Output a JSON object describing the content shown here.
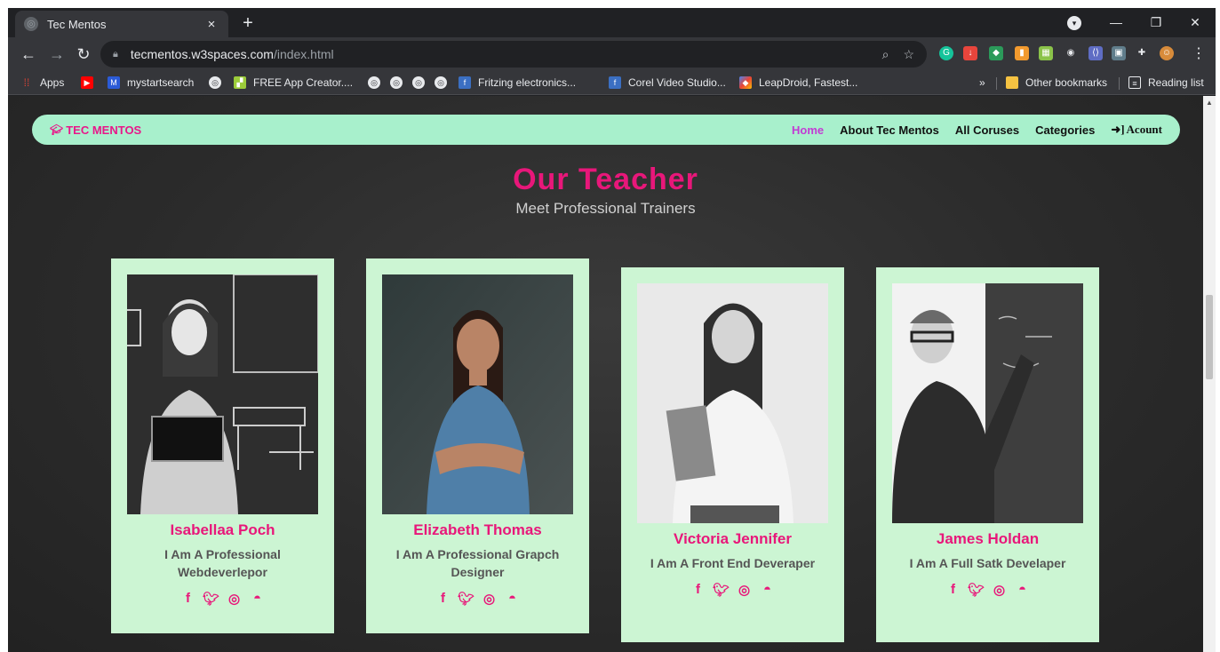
{
  "browser": {
    "tab_title": "Tec Mentos",
    "tab_close": "×",
    "new_tab": "+",
    "url_host": "tecmentos.w3spaces.com",
    "url_path": "/index.html",
    "bookmarks": {
      "apps": "Apps",
      "mystartsearch": "mystartsearch",
      "free_app_creator": "FREE App Creator....",
      "fritzing": "Fritzing electronics...",
      "corel": "Corel Video Studio...",
      "leapdroid": "LeapDroid, Fastest...",
      "more": "»",
      "other_bookmarks": "Other bookmarks",
      "reading_list": "Reading list"
    }
  },
  "site": {
    "brand": "TEC MENTOS",
    "nav": {
      "home": "Home",
      "about": "About Tec Mentos",
      "courses": "All Coruses",
      "categories": "Categories",
      "account": "Acount"
    },
    "heading": "Our Teacher",
    "subheading": "Meet Professional Trainers",
    "teachers": [
      {
        "name": "Isabellaa Poch",
        "desc": "I Am A Professional Webdeverlepor"
      },
      {
        "name": "Elizabeth Thomas",
        "desc": "I Am A Professional Grapch Designer"
      },
      {
        "name": "Victoria Jennifer",
        "desc": "I Am A Front End Deveraper"
      },
      {
        "name": "James Holdan",
        "desc": "I Am A Full Satk Develaper"
      }
    ]
  },
  "colors": {
    "accent_pink": "#e8177a",
    "nav_bg": "#a8f0cc",
    "card_bg": "#ccf5d3",
    "active_link": "#c23bd4"
  },
  "icons": [
    "facebook-icon",
    "twitter-icon",
    "instagram-icon",
    "github-icon",
    "graduation-cap-icon",
    "sign-in-icon"
  ]
}
